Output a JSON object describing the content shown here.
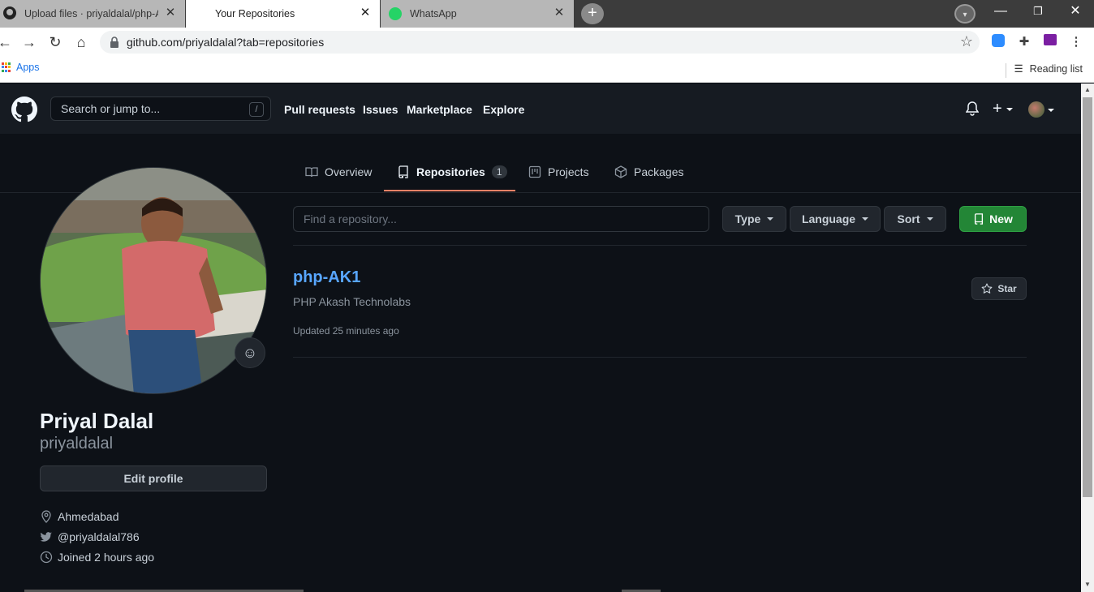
{
  "browser": {
    "tabs": [
      {
        "title": "Upload files · priyaldalal/php-AK1",
        "active": false
      },
      {
        "title": "Your Repositories",
        "active": true
      },
      {
        "title": "WhatsApp",
        "active": false
      }
    ],
    "url": "github.com/priyaldalal?tab=repositories",
    "bookmarks": {
      "apps_label": "Apps",
      "reading_list_label": "Reading list"
    }
  },
  "header": {
    "search_placeholder": "Search or jump to...",
    "search_shortcut": "/",
    "nav": [
      "Pull requests",
      "Issues",
      "Marketplace",
      "Explore"
    ]
  },
  "profile_tabs": [
    {
      "label": "Overview",
      "icon": "book-icon"
    },
    {
      "label": "Repositories",
      "icon": "repo-icon",
      "count": "1",
      "selected": true
    },
    {
      "label": "Projects",
      "icon": "project-icon"
    },
    {
      "label": "Packages",
      "icon": "package-icon"
    }
  ],
  "profile": {
    "full_name": "Priyal Dalal",
    "username": "priyaldalal",
    "edit_label": "Edit profile",
    "location": "Ahmedabad",
    "twitter": "@priyaldalal786",
    "joined": "Joined 2 hours ago"
  },
  "repo_filters": {
    "find_placeholder": "Find a repository...",
    "type_label": "Type",
    "language_label": "Language",
    "sort_label": "Sort",
    "new_label": "New"
  },
  "repositories": [
    {
      "name": "php-AK1",
      "description": "PHP Akash Technolabs",
      "updated": "Updated 25 minutes ago",
      "star_label": "Star"
    }
  ],
  "colors": {
    "accent_link": "#58a6ff",
    "new_button": "#238636",
    "tab_underline": "#f78166",
    "background": "#0d1117"
  }
}
